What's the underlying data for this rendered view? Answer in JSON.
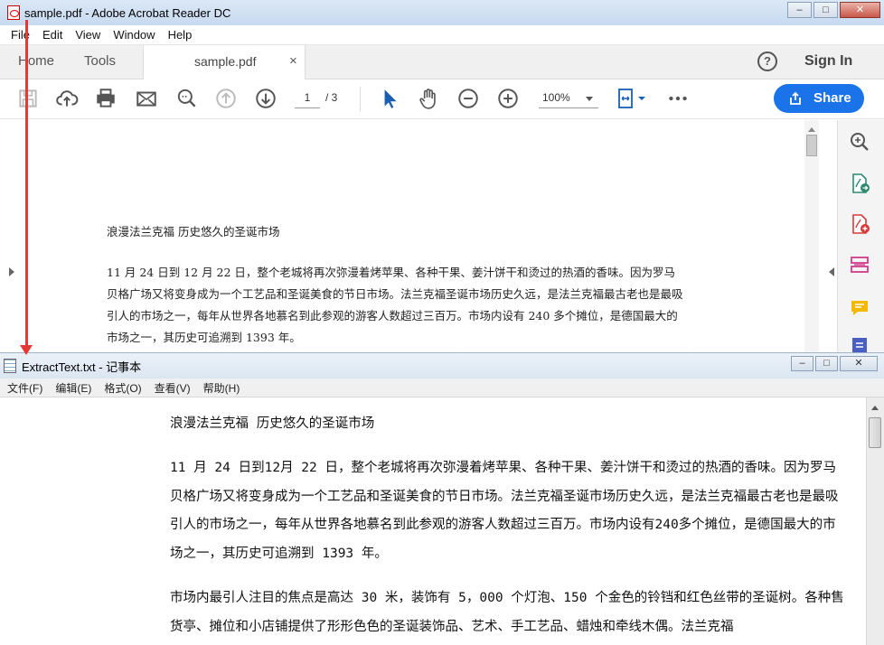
{
  "acrobat": {
    "window_title": "sample.pdf - Adobe Acrobat Reader DC",
    "menu": [
      "File",
      "Edit",
      "View",
      "Window",
      "Help"
    ],
    "tabs": {
      "home": "Home",
      "tools": "Tools",
      "document": "sample.pdf",
      "close": "×"
    },
    "help": "?",
    "sign_in": "Sign In",
    "toolbar": {
      "page_current": "1",
      "page_total": "/ 3",
      "zoom": "100%",
      "share": "Share"
    },
    "page": {
      "heading": "浪漫法兰克福 历史悠久的圣诞市场",
      "paragraph": "11 月 24 日到 12 月 22 日，整个老城将再次弥漫着烤苹果、各种干果、姜汁饼干和烫过的热酒的香味。因为罗马贝格广场又将变身成为一个工艺品和圣诞美食的节日市场。法兰克福圣诞市场历史久远，是法兰克福最古老也是最吸引人的市场之一，每年从世界各地慕名到此参观的游客人数超过三百万。市场内设有 240 多个摊位，是德国最大的市场之一，其历史可追溯到 1393 年。"
    }
  },
  "notepad": {
    "window_title": "ExtractText.txt - 记事本",
    "menu": [
      "文件(F)",
      "编辑(E)",
      "格式(O)",
      "查看(V)",
      "帮助(H)"
    ],
    "heading": "浪漫法兰克福 历史悠久的圣诞市场",
    "paragraph1": "11 月 24 日到12月 22 日，整个老城将再次弥漫着烤苹果、各种干果、姜汁饼干和烫过的热酒的香味。因为罗马贝格广场又将变身成为一个工艺品和圣诞美食的节日市场。法兰克福圣诞市场历史久远，是法兰克福最古老也是最吸引人的市场之一，每年从世界各地慕名到此参观的游客人数超过三百万。市场内设有240多个摊位，是德国最大的市场之一，其历史可追溯到 1393 年。",
    "paragraph2": "市场内最引人注目的焦点是高达 30 米，装饰有 5，000 个灯泡、150 个金色的铃铛和红色丝带的圣诞树。各种售货亭、摊位和小店铺提供了形形色色的圣诞装饰品、艺术、手工艺品、蜡烛和牵线木偶。法兰克福"
  },
  "colors": {
    "share_blue": "#1a73e8",
    "annotation_red": "#e53935"
  },
  "icons": [
    "save-icon",
    "upload-icon",
    "print-icon",
    "mail-icon",
    "zoom-search-icon",
    "page-up-icon",
    "page-down-icon",
    "select-cursor-icon",
    "hand-icon",
    "zoom-out-icon",
    "zoom-in-icon",
    "fit-page-icon",
    "more-icon",
    "search-panel-icon",
    "export-pdf-icon",
    "create-pdf-icon",
    "organize-pages-icon",
    "comment-icon",
    "combine-icon"
  ]
}
